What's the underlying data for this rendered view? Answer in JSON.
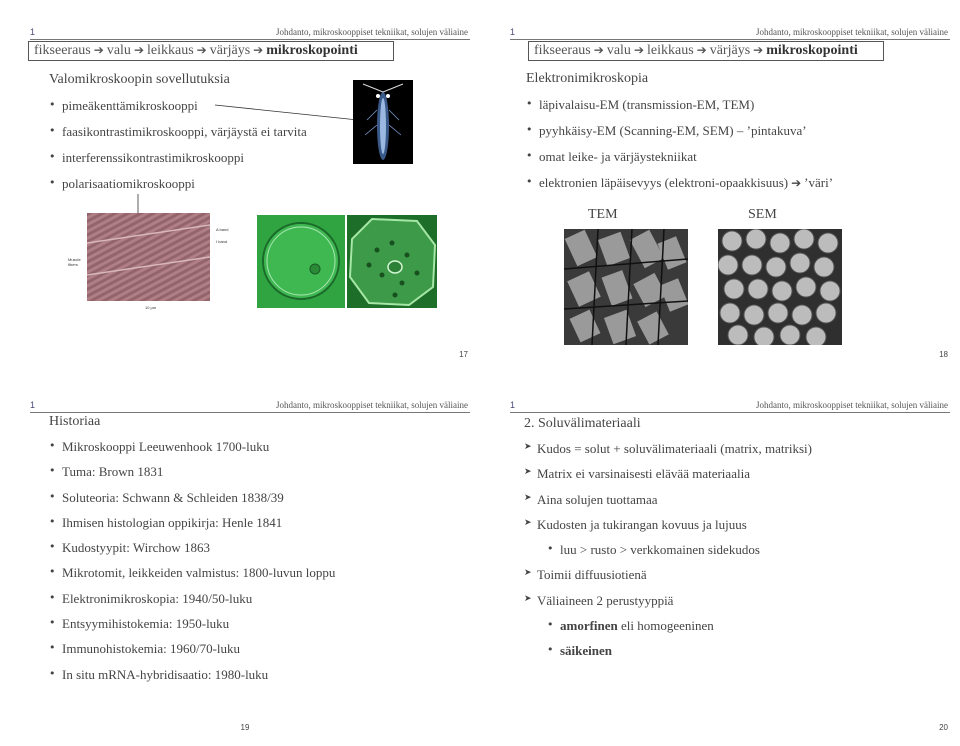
{
  "header_text": "Johdanto, mikroskooppiset tekniikat, solujen väliaine",
  "slide_marker": "1",
  "arrow_glyph": "➔",
  "slide17": {
    "title_parts": [
      "fikseeraus",
      "valu",
      "leikkaus",
      "värjäys"
    ],
    "title_bold": "mikroskopointi",
    "subtitle": "Valomikroskoopin sovellutuksia",
    "bullets": [
      "pimeäkenttämikroskooppi",
      "faasikontrastimikroskooppi, värjäystä ei tarvita",
      "interferenssikontrastimikroskooppi",
      "polarisaatiomikroskooppi"
    ],
    "labels": {
      "a_band": "A band",
      "i_band": "I band",
      "muscle_fibers": "Muscle fibers",
      "scale": "10 μm"
    },
    "page": "17"
  },
  "slide18": {
    "title_parts": [
      "fikseeraus",
      "valu",
      "leikkaus",
      "värjäys"
    ],
    "title_bold": "mikroskopointi",
    "subtitle": "Elektronimikroskopia",
    "bullets": [
      "läpivalaisu-EM (transmission-EM, TEM)",
      "pyyhkäisy-EM (Scanning-EM, SEM)  –  ’pintakuva’",
      "omat leike- ja värjäystekniikat",
      "elektronien läpäisevyys (elektroni-opaakkisuus)",
      "’väri’"
    ],
    "tem_label": "TEM",
    "sem_label": "SEM",
    "page": "18"
  },
  "slide19": {
    "title": "Historiaa",
    "bullets": [
      "Mikroskooppi Leeuwenhook 1700-luku",
      "Tuma: Brown 1831",
      "Soluteoria: Schwann & Schleiden 1838/39",
      "Ihmisen histologian oppikirja: Henle 1841",
      "Kudostyypit: Wirchow 1863",
      "Mikrotomit, leikkeiden valmistus: 1800-luvun loppu",
      "Elektronimikroskopia: 1940/50-luku",
      "Entsyymihistokemia: 1950-luku",
      "Immunohistokemia: 1960/70-luku",
      "In situ mRNA-hybridisaatio: 1980-luku"
    ],
    "page": "19"
  },
  "slide20": {
    "title": "2. Soluvälimateriaali",
    "red_item": "Kudos = solut + soluvälimateriaali (matrix, matriksi)",
    "items": [
      "Matrix ei varsinaisesti elävää materiaalia",
      "Aina solujen tuottamaa",
      "Kudosten ja tukirangan kovuus ja lujuus"
    ],
    "sub_item": "luu > rusto > verkkomainen sidekudos",
    "item_after": "Toimii diffuusiotienä",
    "item_last": "Väliaineen 2 perustyyppiä",
    "sub_items": [
      {
        "bold": "amorfinen",
        "rest": " eli homogeeninen"
      },
      {
        "bold": "säikeinen",
        "rest": ""
      }
    ],
    "page": "20"
  },
  "colors": {
    "red_text": "#cc1111",
    "green_image": "#2a9a3a",
    "muscle_image": "#b07f86"
  },
  "icons": [
    "slide-marker-icon",
    "arrow-icon",
    "bullet-icon",
    "chevron-bullet-icon"
  ]
}
